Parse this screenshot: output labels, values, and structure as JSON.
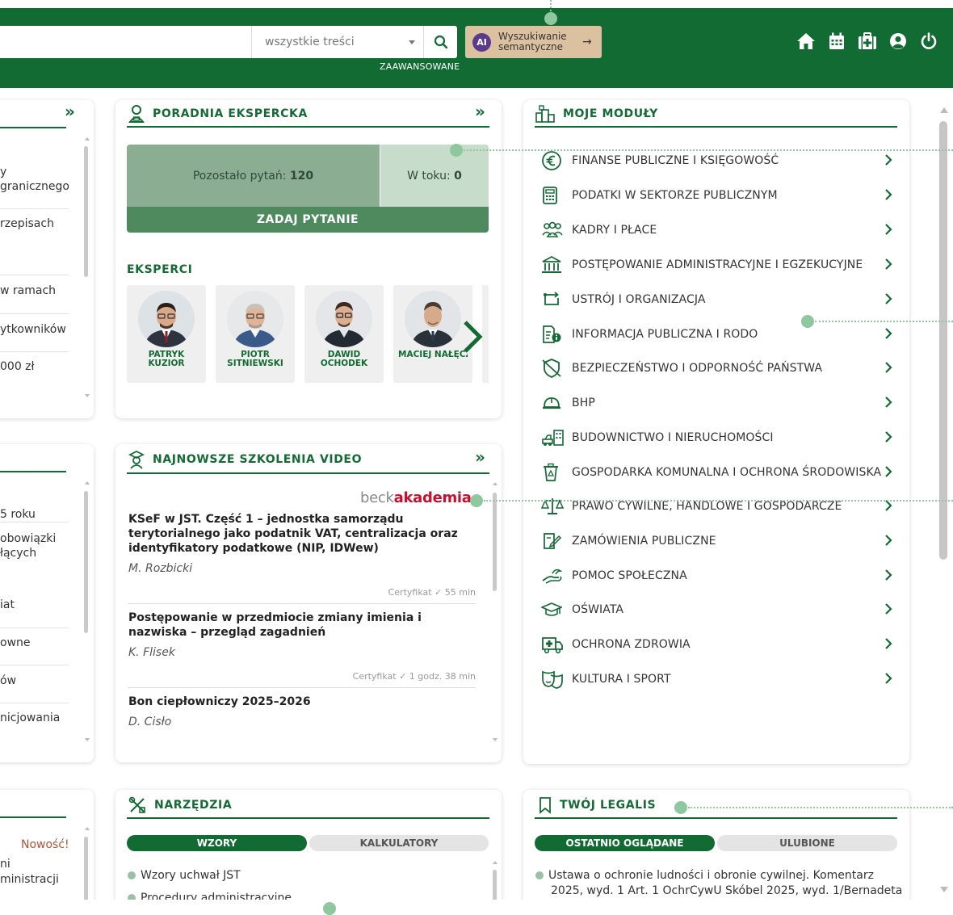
{
  "header": {
    "scope_select": "wszystkie treści",
    "advanced_label": "ZAAWANSOWANE",
    "ai_badge": "AI",
    "semantic_label": "Wyszukiwanie semantyczne",
    "icons": [
      "home-icon",
      "calendar-icon",
      "medical-kit-icon",
      "user-icon",
      "power-icon"
    ]
  },
  "left_cards": {
    "top_items": [
      "y",
      "granicznego",
      "rzepisach",
      "w ramach",
      "ytkowników",
      "000 zł"
    ],
    "middle_items": [
      "5 roku",
      "obowiązki",
      "łących",
      "iat",
      "owne",
      "ów",
      "nicjowania"
    ],
    "bottom_items": [
      "Nowość!",
      "ni",
      "ministracji"
    ]
  },
  "poradnia": {
    "title": "PORADNIA EKSPERCKA",
    "remaining_label": "Pozostało pytań:",
    "remaining_value": "120",
    "in_progress_label": "W toku:",
    "in_progress_value": "0",
    "ask_button": "ZADAJ PYTANIE",
    "experts_heading": "EKSPERCI",
    "experts": [
      {
        "name": "PATRYK\nKUZIOR"
      },
      {
        "name": "PIOTR\nSITNIEWSKI"
      },
      {
        "name": "DAWID\nOCHODEK"
      },
      {
        "name": "MACIEJ NAŁĘCZ"
      }
    ]
  },
  "video": {
    "title": "NAJNOWSZE SZKOLENIA VIDEO",
    "logo_part1": "beck",
    "logo_part2": "akademia",
    "courses": [
      {
        "title": "KSeF w JST. Część 1 – jednostka samorządu terytorialnego jako podatnik VAT, centralizacja oraz identyfikatory podatkowe (NIP, IDWew)",
        "author": "M. Rozbicki",
        "meta": "Certyfikat ✓   55 min"
      },
      {
        "title": "Postępowanie w przedmiocie zmiany imienia i nazwiska – przegląd zagadnień",
        "author": "K. Flisek",
        "meta": "Certyfikat ✓   1 godz. 38 min"
      },
      {
        "title": "Bon ciepłowniczy 2025–2026",
        "author": "D. Cisło",
        "meta": ""
      }
    ]
  },
  "modules": {
    "title": "MOJE MODUŁY",
    "items": [
      {
        "label": "FINANSE PUBLICZNE I KSIĘGOWOŚĆ",
        "icon": "euro-icon"
      },
      {
        "label": "PODATKI W SEKTORZE PUBLICZNYM",
        "icon": "calculator-icon"
      },
      {
        "label": "KADRY I PŁACE",
        "icon": "people-icon"
      },
      {
        "label": "POSTĘPOWANIE ADMINISTRACYJNE I EGZEKUCYJNE",
        "icon": "building-icon"
      },
      {
        "label": "USTRÓJ I ORGANIZACJA",
        "icon": "org-structure-icon"
      },
      {
        "label": "INFORMACJA PUBLICZNA I RODO",
        "icon": "info-document-icon"
      },
      {
        "label": "BEZPIECZEŃSTWO I ODPORNOŚĆ PAŃSTWA",
        "icon": "shield-icon"
      },
      {
        "label": "BHP",
        "icon": "helmet-icon"
      },
      {
        "label": "BUDOWNICTWO I NIERUCHOMOŚCI",
        "icon": "construction-icon"
      },
      {
        "label": "GOSPODARKA KOMUNALNA I OCHRONA ŚRODOWISKA",
        "icon": "recycle-bin-icon"
      },
      {
        "label": "PRAWO CYWILNE, HANDLOWE I GOSPODARCZE",
        "icon": "scales-icon"
      },
      {
        "label": "ZAMÓWIENIA PUBLICZNE",
        "icon": "contract-icon"
      },
      {
        "label": "POMOC SPOŁECZNA",
        "icon": "helping-hand-icon"
      },
      {
        "label": "OŚWIATA",
        "icon": "graduation-cap-icon"
      },
      {
        "label": "OCHRONA ZDROWIA",
        "icon": "ambulance-icon"
      },
      {
        "label": "KULTURA I SPORT",
        "icon": "theatre-masks-icon"
      }
    ]
  },
  "tools": {
    "title": "NARZĘDZIA",
    "tab_active": "WZORY",
    "tab_inactive": "KALKULATORY",
    "items": [
      "Wzory uchwał JST",
      "Procedury administracyjne"
    ]
  },
  "legalis": {
    "title": "TWÓJ LEGALIS",
    "tab_active": "OSTATNIO OGLĄDANE",
    "tab_inactive": "ULUBIONE",
    "item_line1": "Ustawa o ochronie ludności i obronie cywilnej. Komentarz",
    "item_line2": "2025, wyd. 1 Art. 1 OchrCywU Skóbel 2025, wyd. 1/Bernadeta"
  },
  "colors": {
    "brand_green": "#136b34",
    "semantic_button": "#dcc1a1",
    "annotation_green": "#8fc79f",
    "beck_red": "#c8102e"
  }
}
